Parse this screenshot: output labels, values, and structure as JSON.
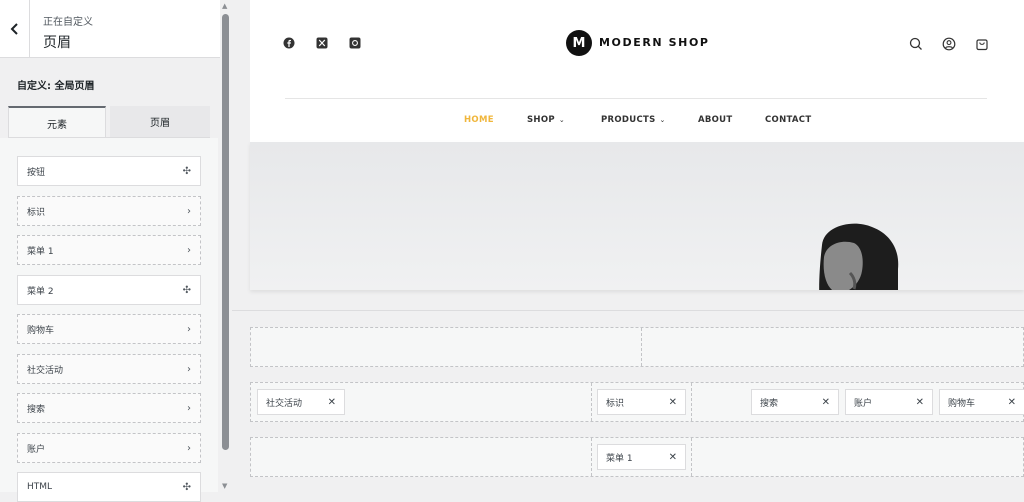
{
  "sidebar": {
    "back_label": "",
    "sub_label": "正在自定义",
    "title": "页眉",
    "section_title": "自定义: 全局页眉",
    "tabs": [
      {
        "label": "元素"
      },
      {
        "label": "页眉"
      }
    ],
    "elements": [
      {
        "label": "按钮",
        "icon": "move-icon"
      },
      {
        "label": "标识",
        "icon": "chevron-right-icon"
      },
      {
        "label": "菜单 1",
        "icon": "chevron-right-icon"
      },
      {
        "label": "菜单 2",
        "icon": "move-icon"
      },
      {
        "label": "购物车",
        "icon": "chevron-right-icon"
      },
      {
        "label": "社交活动",
        "icon": "chevron-right-icon"
      },
      {
        "label": "搜索",
        "icon": "chevron-right-icon"
      },
      {
        "label": "账户",
        "icon": "chevron-right-icon"
      },
      {
        "label": "HTML",
        "icon": "move-icon"
      }
    ]
  },
  "preview": {
    "logo_letter": "M",
    "logo_text": "MODERN SHOP",
    "nav": [
      {
        "label": "HOME",
        "active": true
      },
      {
        "label": "SHOP",
        "dropdown": true
      },
      {
        "label": "PRODUCTS",
        "dropdown": true
      },
      {
        "label": "ABOUT"
      },
      {
        "label": "CONTACT"
      }
    ],
    "accent_color": "#f0b63b"
  },
  "builder": {
    "row2": {
      "left": [
        {
          "label": "社交活动"
        }
      ],
      "center": [
        {
          "label": "标识"
        }
      ],
      "right": [
        {
          "label": "搜索"
        },
        {
          "label": "账户"
        },
        {
          "label": "购物车"
        }
      ]
    },
    "row3": {
      "center": [
        {
          "label": "菜单 1"
        }
      ]
    }
  }
}
